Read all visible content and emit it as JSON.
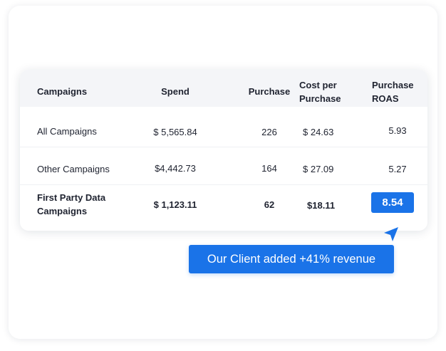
{
  "table": {
    "headers": {
      "campaigns": "Campaigns",
      "spend": "Spend",
      "purchase": "Purchase",
      "cost_per_purchase_line1": "Cost per",
      "cost_per_purchase_line2": "Purchase",
      "roas_line1": "Purchase",
      "roas_line2": "ROAS"
    },
    "rows": [
      {
        "campaign": "All Campaigns",
        "spend": "$ 5,565.84",
        "purchase": "226",
        "cost_per_purchase": "$ 24.63",
        "roas": "5.93"
      },
      {
        "campaign": "Other Campaigns",
        "spend": "$4,442.73",
        "purchase": "164",
        "cost_per_purchase": "$ 27.09",
        "roas": "5.27"
      },
      {
        "campaign_line1": "First Party Data",
        "campaign_line2": "Campaigns",
        "spend": "$ 1,123.11",
        "purchase": "62",
        "cost_per_purchase": "$18.11",
        "roas": "8.54"
      }
    ]
  },
  "callout": {
    "text": "Our Client added +41% revenue"
  },
  "colors": {
    "accent": "#1a73e8",
    "header_bg": "#f4f5f8"
  },
  "icons": {
    "pointer": "cursor-arrow-icon"
  }
}
